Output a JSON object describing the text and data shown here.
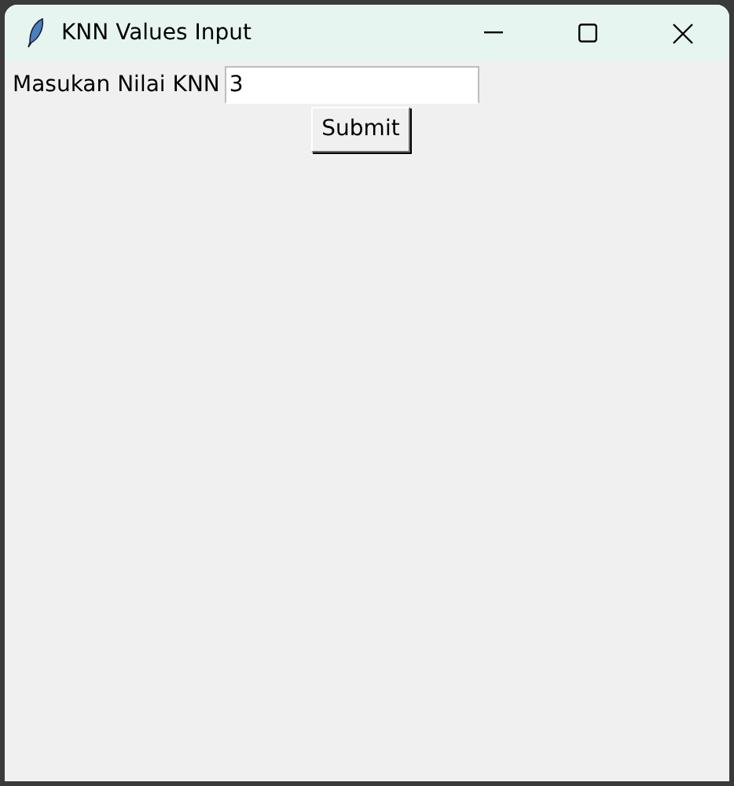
{
  "window": {
    "title": "KNN Values Input"
  },
  "form": {
    "label": "Masukan Nilai KNN",
    "value": "3"
  },
  "buttons": [
    "Submit"
  ]
}
